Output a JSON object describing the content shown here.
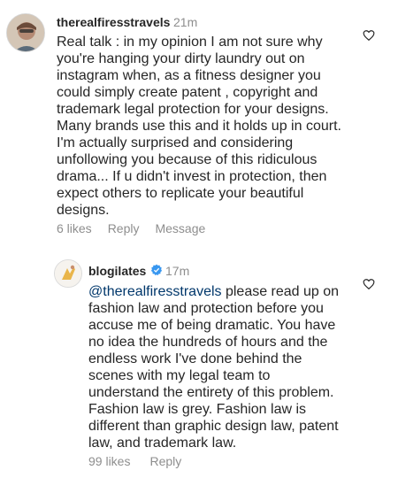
{
  "comments": [
    {
      "username": "therealfiresstravels",
      "time": "21m",
      "text": "Real talk : in my opinion I am not sure why you're hanging your dirty laundry out on instagram when, as a fitness designer you could simply create patent , copyright and trademark legal protection for your designs. Many brands use this and it holds up in court. I'm actually surprised and considering unfollowing you because of this ridiculous drama... If u didn't invest in protection, then expect others to replicate your beautiful designs.",
      "likes": "6 likes",
      "reply": "Reply",
      "message": "Message"
    },
    {
      "username": "blogilates",
      "time": "17m",
      "mention": "@therealfiresstravels",
      "text": " please read up on fashion law and protection before you accuse me of being dramatic. You have no idea the hundreds of hours and the endless work I've done behind the scenes with my legal team to understand the entirety of this problem. Fashion law is grey. Fashion law is different than graphic design law, patent law, and trademark law.",
      "likes": "99 likes",
      "reply": "Reply"
    }
  ],
  "colors": {
    "text": "#262626",
    "secondary": "#8e8e8e",
    "mention": "#00376b",
    "verified": "#3897f0"
  }
}
